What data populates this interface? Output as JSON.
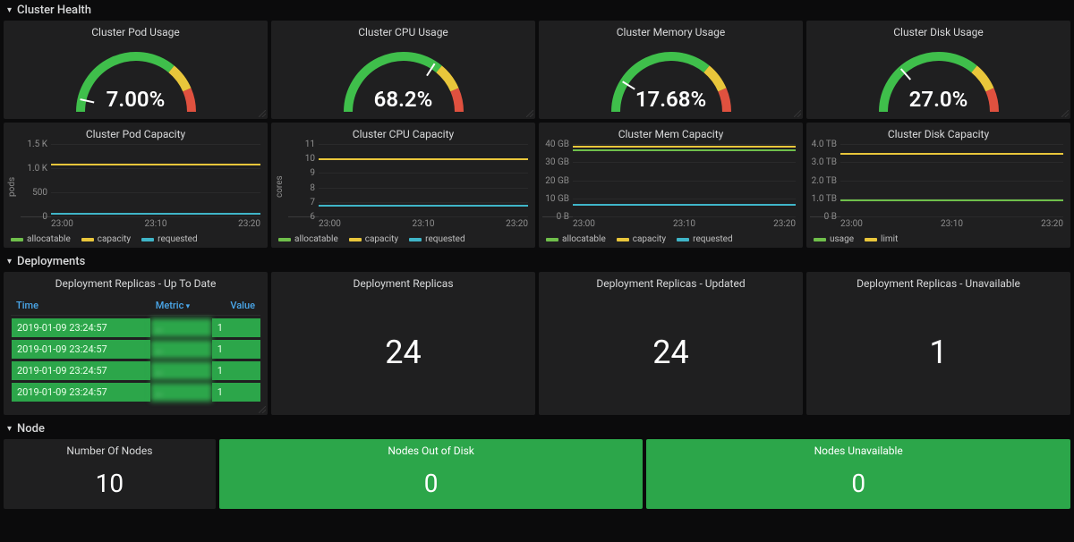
{
  "sections": {
    "cluster_health": "Cluster Health",
    "deployments": "Deployments",
    "node": "Node"
  },
  "gauges": [
    {
      "title": "Cluster Pod Usage",
      "value": "7.00%",
      "pct": 7.0
    },
    {
      "title": "Cluster CPU Usage",
      "value": "68.2%",
      "pct": 68.2
    },
    {
      "title": "Cluster Memory Usage",
      "value": "17.68%",
      "pct": 17.68
    },
    {
      "title": "Cluster Disk Usage",
      "value": "27.0%",
      "pct": 27.0
    }
  ],
  "capacity": [
    {
      "title": "Cluster Pod Capacity",
      "ylabel": "pods",
      "legend": [
        "allocatable",
        "capacity",
        "requested"
      ],
      "legend_colors": [
        "#6fbf4b",
        "#e9c63b",
        "#3fb5c8"
      ],
      "ticks_y": [
        "0",
        "500",
        "1.0 K",
        "1.5 K"
      ],
      "ticks_x": [
        "23:00",
        "23:10",
        "23:20"
      ]
    },
    {
      "title": "Cluster CPU Capacity",
      "ylabel": "cores",
      "legend": [
        "allocatable",
        "capacity",
        "requested"
      ],
      "legend_colors": [
        "#6fbf4b",
        "#e9c63b",
        "#3fb5c8"
      ],
      "ticks_y": [
        "6",
        "7",
        "8",
        "9",
        "10",
        "11"
      ],
      "ticks_x": [
        "23:00",
        "23:10",
        "23:20"
      ]
    },
    {
      "title": "Cluster Mem Capacity",
      "ylabel": "",
      "legend": [
        "allocatable",
        "capacity",
        "requested"
      ],
      "legend_colors": [
        "#6fbf4b",
        "#e9c63b",
        "#3fb5c8"
      ],
      "ticks_y": [
        "0 B",
        "10 GB",
        "20 GB",
        "30 GB",
        "40 GB"
      ],
      "ticks_x": [
        "23:00",
        "23:10",
        "23:20"
      ]
    },
    {
      "title": "Cluster Disk Capacity",
      "ylabel": "",
      "legend": [
        "usage",
        "limit"
      ],
      "legend_colors": [
        "#6fbf4b",
        "#e9c63b"
      ],
      "ticks_y": [
        "0 B",
        "1.0 TB",
        "2.0 TB",
        "3.0 TB",
        "4.0 TB"
      ],
      "ticks_x": [
        "23:00",
        "23:10",
        "23:20"
      ]
    }
  ],
  "chart_data": [
    {
      "type": "line",
      "title": "Cluster Pod Capacity",
      "ylabel": "pods",
      "xlabel": "",
      "ylim": [
        0,
        1500
      ],
      "x_ticks": [
        "23:00",
        "23:10",
        "23:20"
      ],
      "series": [
        {
          "name": "allocatable",
          "value_flat": 1100
        },
        {
          "name": "capacity",
          "value_flat": 1100
        },
        {
          "name": "requested",
          "value_flat": 77
        }
      ]
    },
    {
      "type": "line",
      "title": "Cluster CPU Capacity",
      "ylabel": "cores",
      "xlabel": "",
      "ylim": [
        6,
        11
      ],
      "x_ticks": [
        "23:00",
        "23:10",
        "23:20"
      ],
      "series": [
        {
          "name": "allocatable",
          "value_flat": 10.0
        },
        {
          "name": "capacity",
          "value_flat": 10.0
        },
        {
          "name": "requested",
          "value_flat": 6.8
        }
      ]
    },
    {
      "type": "line",
      "title": "Cluster Mem Capacity",
      "ylabel": "",
      "xlabel": "",
      "ylim_gb": [
        0,
        40
      ],
      "x_ticks": [
        "23:00",
        "23:10",
        "23:20"
      ],
      "series": [
        {
          "name": "allocatable",
          "value_flat_gb": 37.0
        },
        {
          "name": "capacity",
          "value_flat_gb": 39.0
        },
        {
          "name": "requested",
          "value_flat_gb": 6.9
        }
      ]
    },
    {
      "type": "line",
      "title": "Cluster Disk Capacity",
      "ylabel": "",
      "xlabel": "",
      "ylim_tb": [
        0,
        4
      ],
      "x_ticks": [
        "23:00",
        "23:10",
        "23:20"
      ],
      "series": [
        {
          "name": "usage",
          "value_flat_tb": 0.95
        },
        {
          "name": "limit",
          "value_flat_tb": 3.5
        }
      ]
    }
  ],
  "deployments_table": {
    "title": "Deployment Replicas - Up To Date",
    "headers": {
      "time": "Time",
      "metric": "Metric",
      "value": "Value"
    },
    "rows": [
      {
        "time": "2019-01-09 23:24:57",
        "metric": "…",
        "value": "1"
      },
      {
        "time": "2019-01-09 23:24:57",
        "metric": "…",
        "value": "1"
      },
      {
        "time": "2019-01-09 23:24:57",
        "metric": "…",
        "value": "1"
      },
      {
        "time": "2019-01-09 23:24:57",
        "metric": "…",
        "value": "1"
      }
    ]
  },
  "deployment_stats": [
    {
      "title": "Deployment Replicas",
      "value": "24"
    },
    {
      "title": "Deployment Replicas - Updated",
      "value": "24"
    },
    {
      "title": "Deployment Replicas - Unavailable",
      "value": "1"
    }
  ],
  "node_stats": [
    {
      "title": "Number Of Nodes",
      "value": "10",
      "green": false
    },
    {
      "title": "Nodes Out of Disk",
      "value": "0",
      "green": true
    },
    {
      "title": "Nodes Unavailable",
      "value": "0",
      "green": true
    }
  ],
  "colors": {
    "gauge_green": "#3fbf4b",
    "gauge_yellow": "#e9c63b",
    "gauge_red": "#e0513f",
    "gauge_track": "#3a3a3b"
  }
}
